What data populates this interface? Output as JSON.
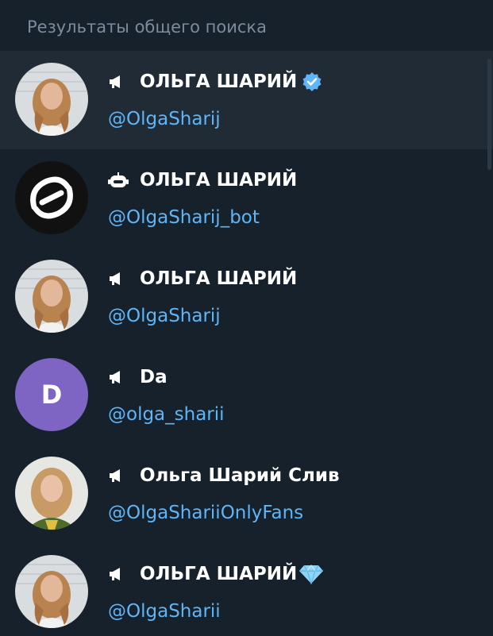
{
  "header": {
    "title": "Результаты общего поиска"
  },
  "results": [
    {
      "name": "ОЛЬГА ШАРИЙ",
      "username": "@OlgaSharij",
      "type_icon": "megaphone-icon",
      "badge": "verified-icon",
      "avatar": "photo",
      "selected": true
    },
    {
      "name": "ОЛЬГА ШАРИЙ",
      "username": "@OlgaSharij_bot",
      "type_icon": "bot-icon",
      "badge": "",
      "avatar": "logo"
    },
    {
      "name": "ОЛЬГА ШАРИЙ",
      "username": "@OlgaSharij",
      "type_icon": "megaphone-icon",
      "badge": "",
      "avatar": "photo"
    },
    {
      "name": "Da",
      "username": "@olga_sharii",
      "type_icon": "megaphone-icon",
      "badge": "",
      "avatar_letter": "D",
      "avatar_color": "#7e65c4"
    },
    {
      "name": "Ольга Шарий Слив",
      "username": "@OlgaShariiOnlyFans",
      "type_icon": "megaphone-icon",
      "badge": "",
      "avatar": "photo"
    },
    {
      "name": "ОЛЬГА ШАРИЙ",
      "username": "@OlgaSharii",
      "type_icon": "megaphone-icon",
      "badge": "diamond-icon",
      "avatar": "photo"
    }
  ],
  "colors": {
    "background": "#17212b",
    "selected_row": "#202b36",
    "username": "#5eb5f7",
    "header_text": "#7c8c9c",
    "verified": "#5eb5f7"
  }
}
